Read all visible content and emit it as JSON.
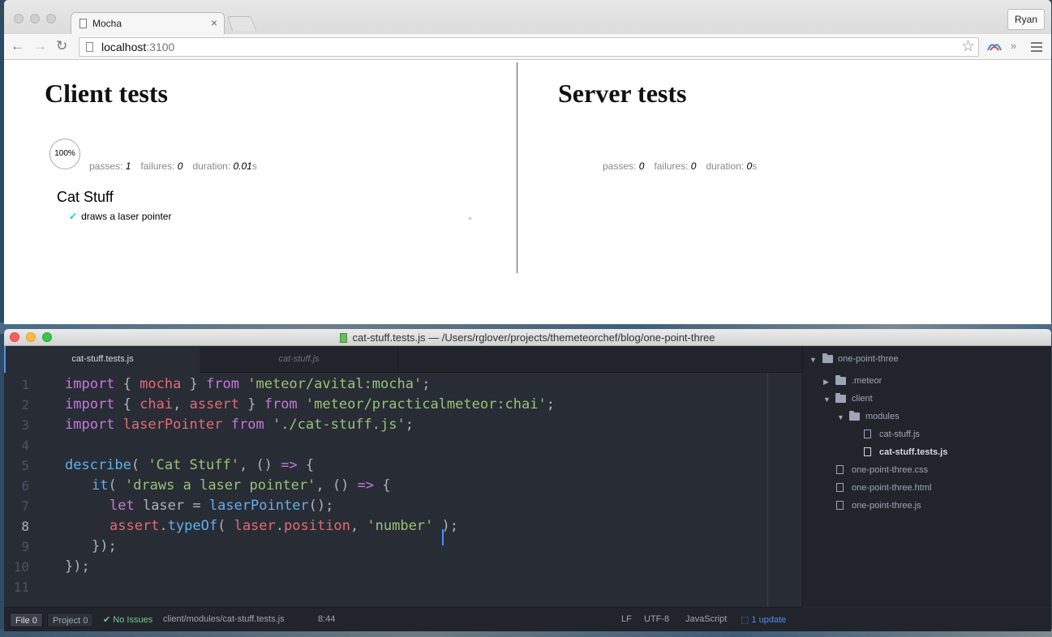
{
  "browser": {
    "tab_title": "Mocha",
    "tab_close": "×",
    "profile_name": "Ryan",
    "url_host": "localhost",
    "url_port": ":3100",
    "nav": {
      "back": "←",
      "forward": "→",
      "reload": "↻"
    },
    "star": "☆",
    "overflow": "»"
  },
  "client_tests": {
    "heading": "Client tests",
    "progress": "100%",
    "stats": {
      "passes_label": "passes:",
      "passes": "1",
      "failures_label": "failures:",
      "failures": "0",
      "duration_label": "duration:",
      "duration": "0.01",
      "duration_unit": "s"
    },
    "suite": "Cat Stuff",
    "test_check": "✓",
    "test_name": "draws a laser pointer"
  },
  "server_tests": {
    "heading": "Server tests",
    "stats": {
      "passes_label": "passes:",
      "passes": "0",
      "failures_label": "failures:",
      "failures": "0",
      "duration_label": "duration:",
      "duration": "0",
      "duration_unit": "s"
    }
  },
  "editor": {
    "window_title": "cat-stuff.tests.js — /Users/rglover/projects/themeteorchef/blog/one-point-three",
    "tabs": [
      {
        "label": "cat-stuff.tests.js",
        "active": true
      },
      {
        "label": "cat-stuff.js",
        "active": false
      }
    ],
    "line_numbers": [
      "1",
      "2",
      "3",
      "4",
      "5",
      "6",
      "7",
      "8",
      "9",
      "10",
      "11"
    ],
    "current_line": "8"
  },
  "tree": {
    "root": "one-point-three",
    "items": [
      {
        "label": ".meteor",
        "type": "folder"
      },
      {
        "label": "client",
        "type": "folder"
      },
      {
        "label": "modules",
        "type": "folder"
      },
      {
        "label": "cat-stuff.js",
        "type": "file"
      },
      {
        "label": "cat-stuff.tests.js",
        "type": "file",
        "selected": true
      },
      {
        "label": "one-point-three.css",
        "type": "file"
      },
      {
        "label": "one-point-three.html",
        "type": "file"
      },
      {
        "label": "one-point-three.js",
        "type": "file"
      }
    ]
  },
  "status": {
    "file_label": "File",
    "file_count": "0",
    "project_label": "Project",
    "project_count": "0",
    "issues": "No Issues",
    "path": "client/modules/cat-stuff.tests.js",
    "cursor_pos": "8:44",
    "line_ending": "LF",
    "encoding": "UTF-8",
    "grammar": "JavaScript",
    "update": "1 update"
  },
  "code": {
    "l1": {
      "a": "import",
      "b": " { ",
      "c": "mocha",
      "d": " } ",
      "e": "from",
      "f": " ",
      "g": "'meteor/avital:mocha'",
      "h": ";"
    },
    "l2": {
      "a": "import",
      "b": " { ",
      "c": "chai",
      "d": ", ",
      "e": "assert",
      "f": " } ",
      "g": "from",
      "h": " ",
      "i": "'meteor/practicalmeteor:chai'",
      "j": ";"
    },
    "l3": {
      "a": "import",
      "b": " ",
      "c": "laserPointer",
      "d": " ",
      "e": "from",
      "f": " ",
      "g": "'./cat-stuff.js'",
      "h": ";"
    },
    "l5": {
      "a": "describe",
      "b": "( ",
      "c": "'Cat Stuff'",
      "d": ", () ",
      "e": "=>",
      "f": " {"
    },
    "l6": {
      "a": "it",
      "b": "( ",
      "c": "'draws a laser pointer'",
      "d": ", () ",
      "e": "=>",
      "f": " {"
    },
    "l7": {
      "a": "let",
      "b": " laser = ",
      "c": "laserPointer",
      "d": "();"
    },
    "l8": {
      "a": "assert",
      "b": ".",
      "c": "typeOf",
      "d": "( ",
      "e": "laser",
      "f": ".",
      "g": "position",
      "h": ", ",
      "i": "'number'",
      "j": " );"
    },
    "l9": "});",
    "l10": "});"
  },
  "colors": {
    "keyword": "#c678dd",
    "variable": "#e06c75",
    "string": "#98c379",
    "function": "#61afef",
    "editor_bg": "#282c34",
    "accent": "#568af2",
    "pass_check": "#00d6b2"
  }
}
